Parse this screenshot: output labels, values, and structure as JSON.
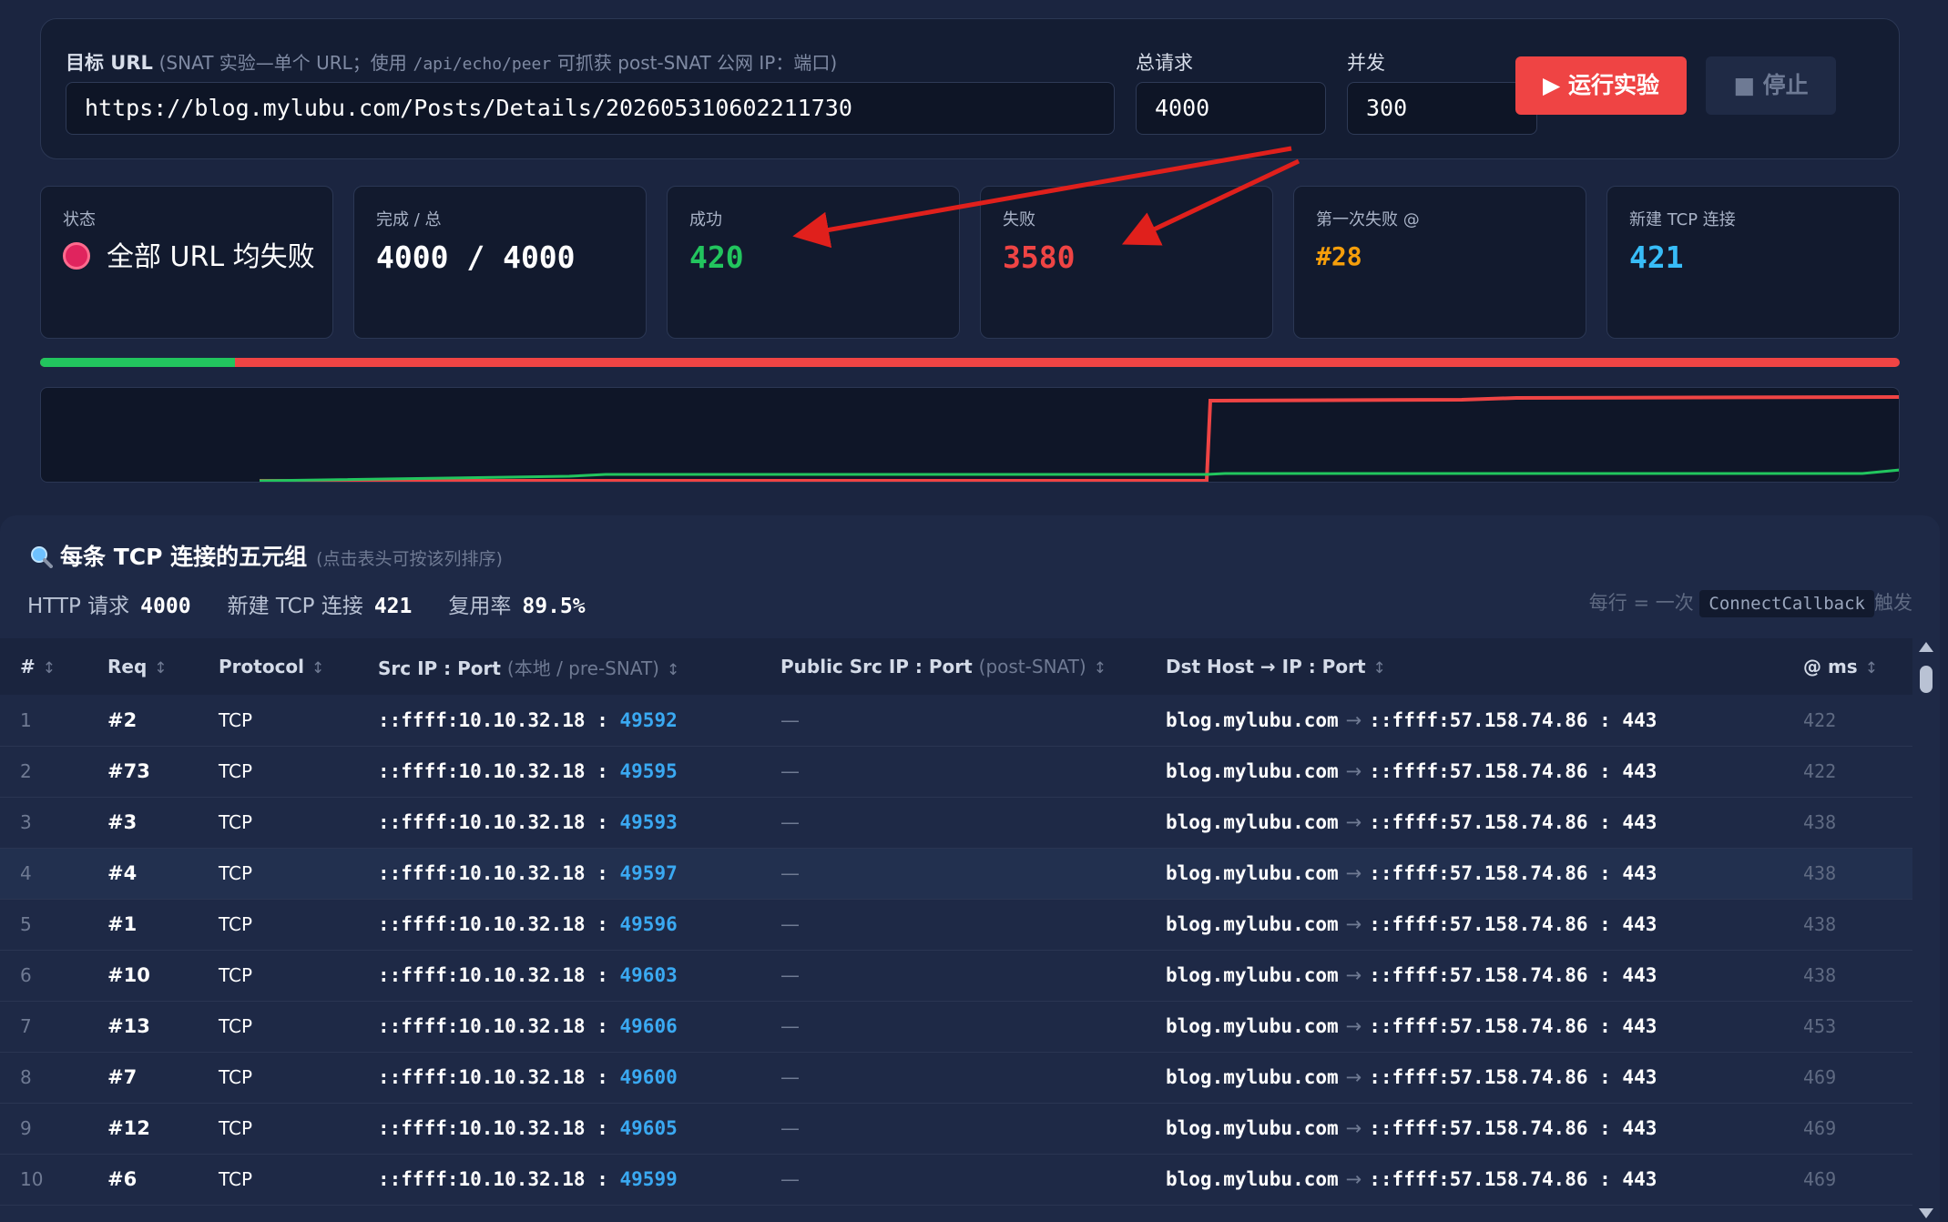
{
  "form": {
    "url_label": "目标 URL",
    "url_label_hint_pre": "(SNAT 实验—单个 URL；使用",
    "url_label_hint_code": "/api/echo/peer",
    "url_label_hint_post": "可抓获 post-SNAT 公网 IP：端口)",
    "url_value": "https://blog.mylubu.com/Posts/Details/202605310602211730",
    "total_label": "总请求",
    "total_value": "4000",
    "concurrency_label": "并发",
    "concurrency_value": "300",
    "run_label": "▶ 运行实验",
    "stop_label": "■ 停止"
  },
  "stats": {
    "status_label": "状态",
    "status_value": "全部 URL 均失败",
    "done_label": "完成 / 总",
    "done_value": "4000 / 4000",
    "success_label": "成功",
    "success_value": "420",
    "fail_label": "失败",
    "fail_value": "3580",
    "first_fail_label": "第一次失败 @",
    "first_fail_value": "#28",
    "new_tcp_label": "新建 TCP 连接",
    "new_tcp_value": "421"
  },
  "progress": {
    "success_fraction": 0.105
  },
  "colors": {
    "success": "#22c55e",
    "failure": "#ef4444",
    "warning": "#f59e0b",
    "info": "#38bdf8",
    "port": "#3aa9f2"
  },
  "section": {
    "title": "每条 TCP 连接的五元组",
    "hint": "(点击表头可按该列排序)",
    "icon": "magnifier-icon",
    "http_label": "HTTP 请求",
    "http_value": "4000",
    "tcp_label": "新建 TCP 连接",
    "tcp_value": "421",
    "reuse_label": "复用率",
    "reuse_value": "89.5%",
    "note_pre": "每行 = 一次",
    "note_code": "ConnectCallback",
    "note_post": "触发"
  },
  "table": {
    "headers": {
      "idx": "#",
      "req": "Req",
      "protocol": "Protocol",
      "src": "Src IP : Port",
      "src_hint": "(本地 / pre-SNAT)",
      "pub": "Public Src IP : Port",
      "pub_hint": "(post-SNAT)",
      "dst": "Dst Host → IP : Port",
      "ms": "@ ms",
      "sort_glyph": "↕"
    },
    "rows": [
      {
        "idx": "1",
        "req": "#2",
        "protocol": "TCP",
        "src_ip": "::ffff:10.10.32.18",
        "src_port": "49592",
        "pub": "—",
        "dst_host": "blog.mylubu.com",
        "dst_ip": "::ffff:57.158.74.86",
        "dst_port": "443",
        "ms": "422"
      },
      {
        "idx": "2",
        "req": "#73",
        "protocol": "TCP",
        "src_ip": "::ffff:10.10.32.18",
        "src_port": "49595",
        "pub": "—",
        "dst_host": "blog.mylubu.com",
        "dst_ip": "::ffff:57.158.74.86",
        "dst_port": "443",
        "ms": "422"
      },
      {
        "idx": "3",
        "req": "#3",
        "protocol": "TCP",
        "src_ip": "::ffff:10.10.32.18",
        "src_port": "49593",
        "pub": "—",
        "dst_host": "blog.mylubu.com",
        "dst_ip": "::ffff:57.158.74.86",
        "dst_port": "443",
        "ms": "438"
      },
      {
        "idx": "4",
        "req": "#4",
        "protocol": "TCP",
        "src_ip": "::ffff:10.10.32.18",
        "src_port": "49597",
        "pub": "—",
        "dst_host": "blog.mylubu.com",
        "dst_ip": "::ffff:57.158.74.86",
        "dst_port": "443",
        "ms": "438"
      },
      {
        "idx": "5",
        "req": "#1",
        "protocol": "TCP",
        "src_ip": "::ffff:10.10.32.18",
        "src_port": "49596",
        "pub": "—",
        "dst_host": "blog.mylubu.com",
        "dst_ip": "::ffff:57.158.74.86",
        "dst_port": "443",
        "ms": "438"
      },
      {
        "idx": "6",
        "req": "#10",
        "protocol": "TCP",
        "src_ip": "::ffff:10.10.32.18",
        "src_port": "49603",
        "pub": "—",
        "dst_host": "blog.mylubu.com",
        "dst_ip": "::ffff:57.158.74.86",
        "dst_port": "443",
        "ms": "438"
      },
      {
        "idx": "7",
        "req": "#13",
        "protocol": "TCP",
        "src_ip": "::ffff:10.10.32.18",
        "src_port": "49606",
        "pub": "—",
        "dst_host": "blog.mylubu.com",
        "dst_ip": "::ffff:57.158.74.86",
        "dst_port": "443",
        "ms": "453"
      },
      {
        "idx": "8",
        "req": "#7",
        "protocol": "TCP",
        "src_ip": "::ffff:10.10.32.18",
        "src_port": "49600",
        "pub": "—",
        "dst_host": "blog.mylubu.com",
        "dst_ip": "::ffff:57.158.74.86",
        "dst_port": "443",
        "ms": "469"
      },
      {
        "idx": "9",
        "req": "#12",
        "protocol": "TCP",
        "src_ip": "::ffff:10.10.32.18",
        "src_port": "49605",
        "pub": "—",
        "dst_host": "blog.mylubu.com",
        "dst_ip": "::ffff:57.158.74.86",
        "dst_port": "443",
        "ms": "469"
      },
      {
        "idx": "10",
        "req": "#6",
        "protocol": "TCP",
        "src_ip": "::ffff:10.10.32.18",
        "src_port": "49599",
        "pub": "—",
        "dst_host": "blog.mylubu.com",
        "dst_ip": "::ffff:57.158.74.86",
        "dst_port": "443",
        "ms": "469"
      }
    ]
  }
}
